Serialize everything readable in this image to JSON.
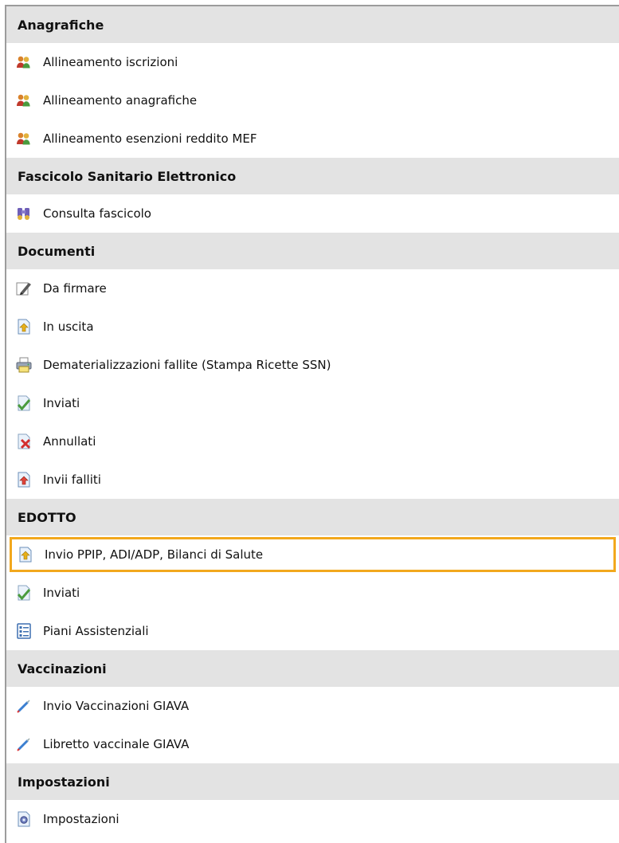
{
  "sections": [
    {
      "title": "Anagrafiche",
      "items": [
        {
          "label": "Allineamento iscrizioni",
          "icon": "users-icon"
        },
        {
          "label": "Allineamento anagrafiche",
          "icon": "users-icon"
        },
        {
          "label": "Allineamento esenzioni reddito MEF",
          "icon": "users-icon"
        }
      ]
    },
    {
      "title": "Fascicolo Sanitario Elettronico",
      "items": [
        {
          "label": "Consulta fascicolo",
          "icon": "binoculars-icon"
        }
      ]
    },
    {
      "title": "Documenti",
      "items": [
        {
          "label": "Da firmare",
          "icon": "pen-icon"
        },
        {
          "label": "In uscita",
          "icon": "doc-out-icon"
        },
        {
          "label": "Dematerializzazioni fallite (Stampa Ricette SSN)",
          "icon": "printer-icon"
        },
        {
          "label": "Inviati",
          "icon": "doc-check-icon"
        },
        {
          "label": "Annullati",
          "icon": "doc-cancel-icon"
        },
        {
          "label": "Invii falliti",
          "icon": "doc-failed-icon"
        }
      ]
    },
    {
      "title": "EDOTTO",
      "items": [
        {
          "label": "Invio PPIP, ADI/ADP, Bilanci di Salute",
          "icon": "doc-out-icon",
          "selected": true
        },
        {
          "label": "Inviati",
          "icon": "doc-check-icon"
        },
        {
          "label": "Piani Assistenziali",
          "icon": "list-icon"
        }
      ]
    },
    {
      "title": "Vaccinazioni",
      "items": [
        {
          "label": "Invio Vaccinazioni GIAVA",
          "icon": "syringe-icon"
        },
        {
          "label": "Libretto vaccinale GIAVA",
          "icon": "syringe-icon"
        }
      ]
    },
    {
      "title": "Impostazioni",
      "items": [
        {
          "label": "Impostazioni",
          "icon": "settings-doc-icon"
        }
      ]
    }
  ],
  "colors": {
    "section_bg": "#e3e3e3",
    "selected_outline": "#f2a81d"
  }
}
